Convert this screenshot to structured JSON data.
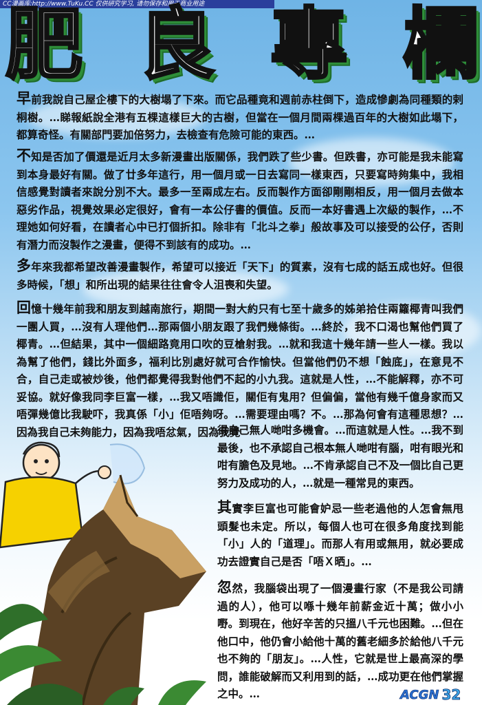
{
  "header": {
    "watermark": "CC漫画库:http://www.TuKu.CC 仅供研究学习, 请勿保存和用于商业用途"
  },
  "title": {
    "chars": [
      "肥",
      "良",
      "專",
      "欄"
    ]
  },
  "paragraphs": [
    {
      "dropcap": "早",
      "text": "前我說自己屋企樓下的大樹塌了下來。而它品種竟和週前赤柱倒下，造成慘劇為同種類的剌桐樹。…睇報紙說全港有五棵這樣巨大的古樹，但當在一個月間兩棵過百年的大樹如此塌下，都算奇怪。有關部門要加倍努力，去檢查有危險可能的東西。…"
    },
    {
      "dropcap": "不",
      "text": "知是否加了價還是近月太多新漫畫出版關係，我們跌了些少書。但跌書，亦可能是我未能寫到本身最好有關。做了廿多年這行，用一個月或一日去寫同一樣東西，只要寫時夠集中，我相信感覺對讀者來說分別不大。最多一至兩成左右。反而製作方面卻剛剛相反，用一個月去做本惡劣作品，視覺效果必定很好，會有一本公仔書的價值。反而一本好書遇上次級的製作，…不理她如何好看，在讀者心中已打個折扣。除非有「北斗之拳」般故事及可以接受的公仔，否則有潛力而沒製作之漫畫，便得不到該有的成功。…"
    },
    {
      "dropcap": "多",
      "text": "年來我都希望改善漫畫製作，希望可以接近「天下」的質素，沒有七成的話五成也好。但很多時候，「想」和所出現的結果往往會令人沮喪和失望。"
    },
    {
      "dropcap": "回",
      "text": "憶十幾年前我和朋友到越南旅行，期間一對大約只有七至十歲多的姊弟拾住兩籮椰青叫我們一團人買，…沒有人理他們…那兩個小朋友跟了我們幾條街。…終於，我不口渴也幫他們買了椰青。…但結果，其中一個細路竟用口吹的豆槍射我。…就和我這十幾年請一些人一樣。我以為幫了他們，錢比外面多，福利比別處好就可合作愉快。但當他們仍不想「蝕底」，在意見不合，自己走或被炒後，他們都覺得我對他們不起的小九我。這就是人性，…不能解釋，亦不可妥協。就好像我同李巨富一樣，…我又唔識佢，關佢有鬼用？但偏偏，當他有幾千億身家而又唔彈幾億比我駛吓，我真係「小」佢唔夠呀。…需要理由嗎？不。…那為何會有這種思想？…因為我自己未夠能力，因為我唔忿氣，因為我覺"
    },
    {
      "text": "得自己無人哋咁多機會。…而這就是人性。…我不到最後，也不承認自己根本無人哋咁有腦，咁有眼光和咁有膽色及見地。…不肯承認自己不及一個比自己更努力及成功的人，…就是一種常見的東西。"
    },
    {
      "dropcap": "其",
      "text": "實李巨富也可能會妒忌一些老過他的人怎會無甩頭髮也未定。所以，每個人也可在很多角度找到能「小」人的「道理」。而那人有用或無用，就必要成功去證實自己是否「唔Ｘ晒」。…"
    },
    {
      "dropcap": "忽",
      "text": "然，我腦袋出現了一個漫畫行家（不是我公司請過的人），他可以喺十幾年前薪金近十萬；做小小嘢。到現在，他好辛苦的只搵八千元也困難。…但在他口中，他仍會小給他十萬的舊老細多於給他八千元也不夠的「朋友」。…人性，它就是世上最高深的學問，誰能破解而又利用到的話，…成功更在他們掌握之中。…"
    }
  ],
  "footer": {
    "logo": "ACGN",
    "page_number": "32"
  }
}
